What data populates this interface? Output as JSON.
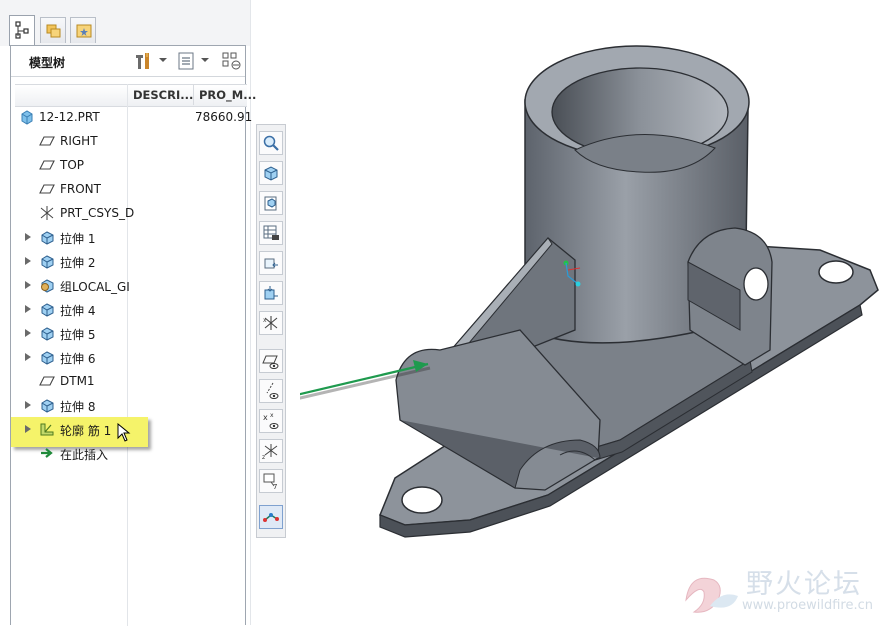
{
  "tabs": [
    {
      "name": "model-tree-tab-icon",
      "active": true
    },
    {
      "name": "folder-browser-tab-icon",
      "active": false
    },
    {
      "name": "favorites-tab-icon",
      "active": false
    }
  ],
  "panel": {
    "title": "模型树",
    "columns": [
      "DESCRI...",
      "PRO_M..."
    ]
  },
  "tree": {
    "root": {
      "label": "12-12.PRT",
      "value": "78660.91"
    },
    "items": [
      {
        "label": "RIGHT",
        "icon": "datum-plane-icon",
        "expandable": false
      },
      {
        "label": "TOP",
        "icon": "datum-plane-icon",
        "expandable": false
      },
      {
        "label": "FRONT",
        "icon": "datum-plane-icon",
        "expandable": false
      },
      {
        "label": "PRT_CSYS_D",
        "icon": "csys-icon",
        "expandable": false
      },
      {
        "label": "拉伸 1",
        "icon": "extrude-icon",
        "expandable": true
      },
      {
        "label": "拉伸 2",
        "icon": "extrude-icon",
        "expandable": true
      },
      {
        "label": "组LOCAL_GI",
        "icon": "group-icon",
        "expandable": true
      },
      {
        "label": "拉伸 4",
        "icon": "extrude-icon",
        "expandable": true
      },
      {
        "label": "拉伸 5",
        "icon": "extrude-icon",
        "expandable": true
      },
      {
        "label": "拉伸 6",
        "icon": "extrude-icon",
        "expandable": true
      },
      {
        "label": "DTM1",
        "icon": "datum-plane-icon",
        "expandable": false
      },
      {
        "label": "拉伸 8",
        "icon": "extrude-icon",
        "expandable": true
      },
      {
        "label": "轮廓 筋 1",
        "icon": "profile-rib-icon",
        "expandable": true,
        "highlighted": true
      },
      {
        "label": "在此插入",
        "icon": "insert-here-icon",
        "expandable": false
      }
    ]
  },
  "toolbar_icons": [
    "zoom-icon",
    "view-cube-icon",
    "saved-views-icon",
    "view-manager-icon",
    "reorient-icon",
    "spin-center-icon",
    "csys-display-icon",
    "plane-display-icon",
    "axis-display-icon",
    "point-display-icon",
    "csys-tag-icon",
    "annotation-display-icon",
    "model-display-icon"
  ],
  "colors": {
    "highlight": "#f5f36a",
    "arrow": "#1f9a4e",
    "model": "#8a909a"
  },
  "watermark": {
    "name": "野火论坛",
    "url": "www.proewildfire.cn"
  }
}
